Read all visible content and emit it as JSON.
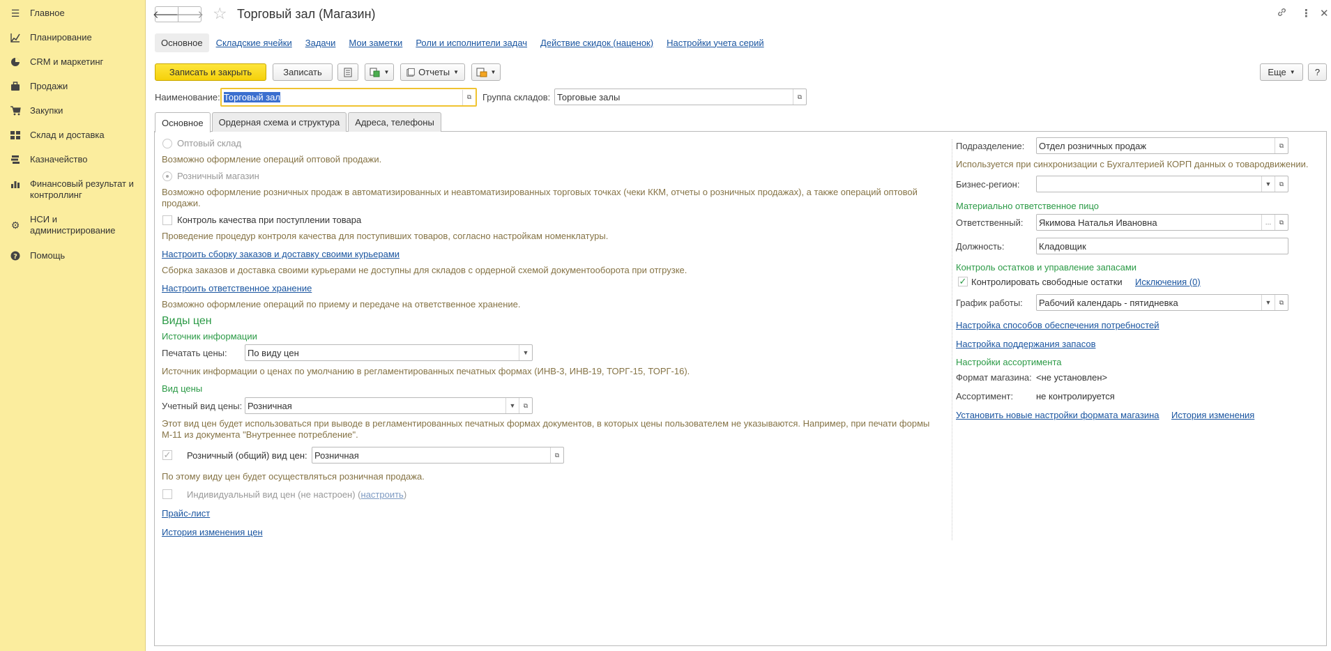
{
  "sidebar": {
    "items": [
      {
        "label": "Главное",
        "icon": "menu-icon"
      },
      {
        "label": "Планирование",
        "icon": "planning-icon"
      },
      {
        "label": "CRM и маркетинг",
        "icon": "crm-icon"
      },
      {
        "label": "Продажи",
        "icon": "sales-icon"
      },
      {
        "label": "Закупки",
        "icon": "cart-icon"
      },
      {
        "label": "Склад и доставка",
        "icon": "warehouse-icon"
      },
      {
        "label": "Казначейство",
        "icon": "treasury-icon"
      },
      {
        "label": "Финансовый результат и контроллинг",
        "icon": "finance-chart-icon"
      },
      {
        "label": "НСИ и администрирование",
        "icon": "gear-icon"
      },
      {
        "label": "Помощь",
        "icon": "help-icon"
      }
    ]
  },
  "header": {
    "title": "Торговый зал (Магазин)",
    "back_glyph": "🡐",
    "fwd_glyph": "🡒"
  },
  "top_tabs": [
    "Основное",
    "Складские ячейки",
    "Задачи",
    "Мои заметки",
    "Роли и исполнители задач",
    "Действие скидок (наценок)",
    "Настройки учета серий"
  ],
  "toolbar": {
    "save_close": "Записать и закрыть",
    "save": "Записать",
    "reports": "Отчеты",
    "more": "Еще",
    "help": "?"
  },
  "name_field": {
    "label": "Наименование:",
    "value": "Торговый зал"
  },
  "group_field": {
    "label": "Группа складов:",
    "value": "Торговые залы"
  },
  "form_tabs": [
    "Основное",
    "Ордерная схема и структура",
    "Адреса, телефоны"
  ],
  "left": {
    "wholesale_label": "Оптовый склад",
    "wholesale_hint": "Возможно оформление операций оптовой продажи.",
    "retail_label": "Розничный магазин",
    "retail_hint_1": "Возможно оформление розничных продаж в автоматизированных и неавтоматизированных торговых точках (чеки ККМ, отчеты о розничных продажах), а также операций оптовой",
    "retail_hint_2": "продажи.",
    "quality_label": "Контроль качества при поступлении товара",
    "quality_hint": "Проведение процедур контроля качества для поступивших товаров, согласно настройкам номенклатуры.",
    "courier_link": "Настроить сборку заказов и доставку своими курьерами",
    "courier_hint": "Сборка заказов и доставка своими курьерами не доступны для складов с ордерной схемой документооборота при отгрузке.",
    "storage_link": "Настроить ответственное хранение",
    "storage_hint": "Возможно оформление операций по приему и передаче на ответственное хранение.",
    "prices_header": "Виды цен",
    "source_header": "Источник информации",
    "print_price_label": "Печатать цены:",
    "print_price_value": "По виду цен",
    "source_hint": "Источник информации о ценах по умолчанию в регламентированных печатных формах (ИНВ-3, ИНВ-19, ТОРГ-15, ТОРГ-16).",
    "price_type_header": "Вид цены",
    "account_price_label": "Учетный вид цены:",
    "account_price_value": "Розничная",
    "account_hint_1": "Этот вид цен будет использоваться при выводе в регламентированных печатных формах документов, в которых цены пользователем не указываются. Например, при печати формы",
    "account_hint_2": "М-11 из документа \"Внутреннее потребление\".",
    "retail_price_label": "Розничный (общий) вид цен:",
    "retail_price_value": "Розничная",
    "retail_price_hint": "По этому виду цен будет осуществляться розничная продажа.",
    "individual_label": "Индивидуальный вид цен (не настроен) (",
    "individual_link": "настроить",
    "individual_close": ")",
    "pricelist_link": "Прайс-лист",
    "history_link": "История изменения цен"
  },
  "right": {
    "division_label": "Подразделение:",
    "division_value": "Отдел розничных продаж",
    "division_hint": "Используется при синхронизации с Бухгалтерией КОРП данных о товародвижении.",
    "region_label": "Бизнес-регион:",
    "region_value": "",
    "mol_header": "Материально ответственное пицо",
    "responsible_label": "Ответственный:",
    "responsible_value": "Якимова Наталья Ивановна",
    "position_label": "Должность:",
    "position_value": "Кладовщик",
    "stock_header": "Контроль остатков и управление запасами",
    "control_label": "Контролировать свободные остатки",
    "exceptions_link": "Исключения (0)",
    "schedule_label": "График работы:",
    "schedule_value": "Рабочий календарь - пятидневка",
    "supply_link": "Настройка способов обеспечения потребностей",
    "stock_link": "Настройка поддержания запасов",
    "assortment_header": "Настройки ассортимента",
    "format_label": "Формат магазина:",
    "format_value": "<не установлен>",
    "assortment_label": "Ассортимент:",
    "assortment_value": "не контролируется",
    "newformat_link": "Установить новые настройки формата магазина",
    "changes_link": "История изменения"
  }
}
